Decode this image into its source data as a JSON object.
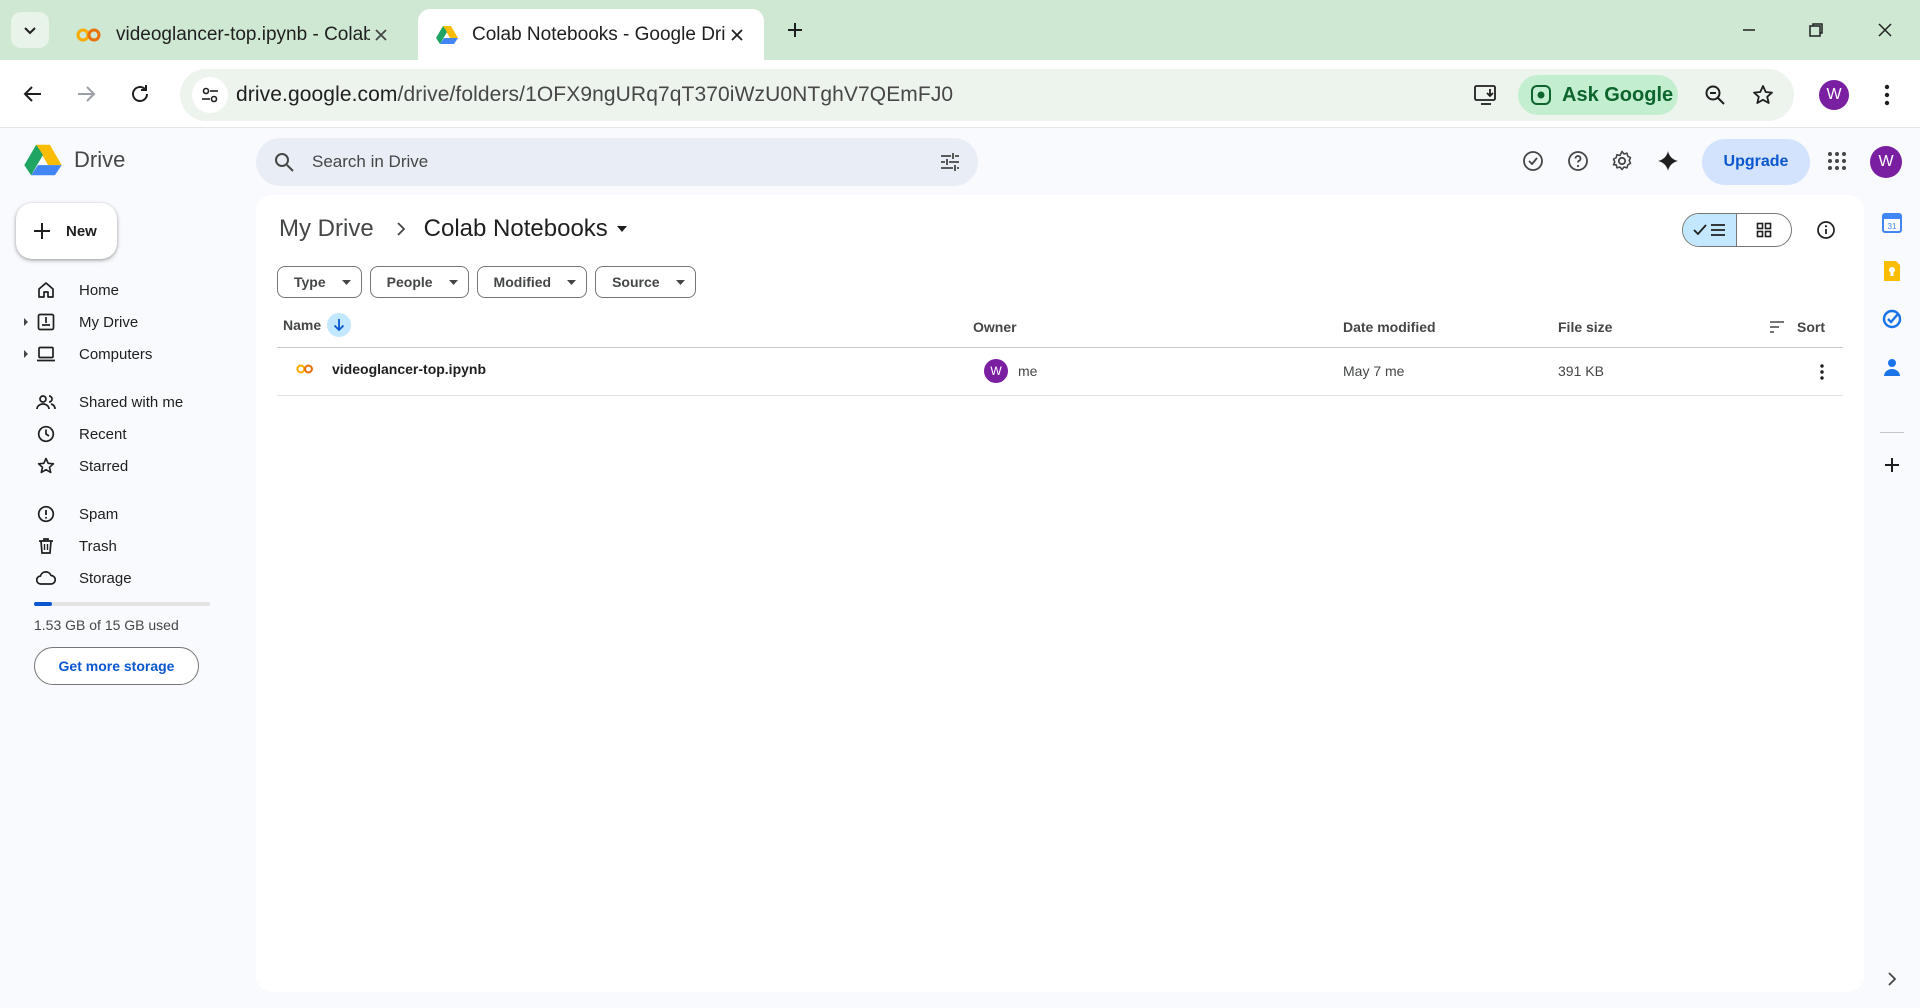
{
  "browser": {
    "tabs": [
      {
        "title": "videoglancer-top.ipynb - Colab",
        "icon": "colab-icon",
        "active": false
      },
      {
        "title": "Colab Notebooks - Google Drive",
        "icon": "google-drive-icon",
        "active": true
      }
    ],
    "url_host": "drive.google.com",
    "url_path": "/drive/folders/1OFX9ngURq7qT370iWzU0NTghV7QEmFJ0",
    "ask_google_label": "Ask Google",
    "profile_initial": "W"
  },
  "drive": {
    "app_name": "Drive",
    "search_placeholder": "Search in Drive",
    "upgrade_label": "Upgrade",
    "avatar_initial": "W",
    "header_icons": [
      "ready-for-offline-icon",
      "help-icon",
      "settings-icon",
      "gemini-sparkle-icon",
      "apps-grid-icon"
    ]
  },
  "sidebar": {
    "new_label": "New",
    "items": [
      {
        "label": "Home",
        "icon": "home-icon"
      },
      {
        "label": "My Drive",
        "icon": "my-drive-icon"
      },
      {
        "label": "Computers",
        "icon": "computers-icon"
      },
      {
        "label": "Shared with me",
        "icon": "shared-icon"
      },
      {
        "label": "Recent",
        "icon": "clock-icon"
      },
      {
        "label": "Starred",
        "icon": "star-icon"
      },
      {
        "label": "Spam",
        "icon": "spam-icon"
      },
      {
        "label": "Trash",
        "icon": "trash-icon"
      },
      {
        "label": "Storage",
        "icon": "cloud-icon"
      }
    ],
    "storage_used_text": "1.53 GB of 15 GB used",
    "storage_fraction": 0.102,
    "get_storage_label": "Get more storage"
  },
  "main": {
    "breadcrumb_root": "My Drive",
    "breadcrumb_current": "Colab Notebooks",
    "filters": [
      "Type",
      "People",
      "Modified",
      "Source"
    ],
    "columns": {
      "name": "Name",
      "owner": "Owner",
      "date": "Date modified",
      "size": "File size",
      "sort": "Sort"
    },
    "rows": [
      {
        "name": "videoglancer-top.ipynb",
        "owner_initial": "W",
        "owner": "me",
        "date": "May 7 me",
        "size": "391 KB"
      }
    ]
  },
  "side_panel": [
    "calendar-icon",
    "keep-icon",
    "tasks-icon",
    "contacts-icon",
    "add-icon"
  ],
  "colors": {
    "accent": "#0b57d0",
    "selected_chip": "#c2e7ff",
    "avatar": "#7b1fa2",
    "tabstrip": "#cfe8d3"
  }
}
